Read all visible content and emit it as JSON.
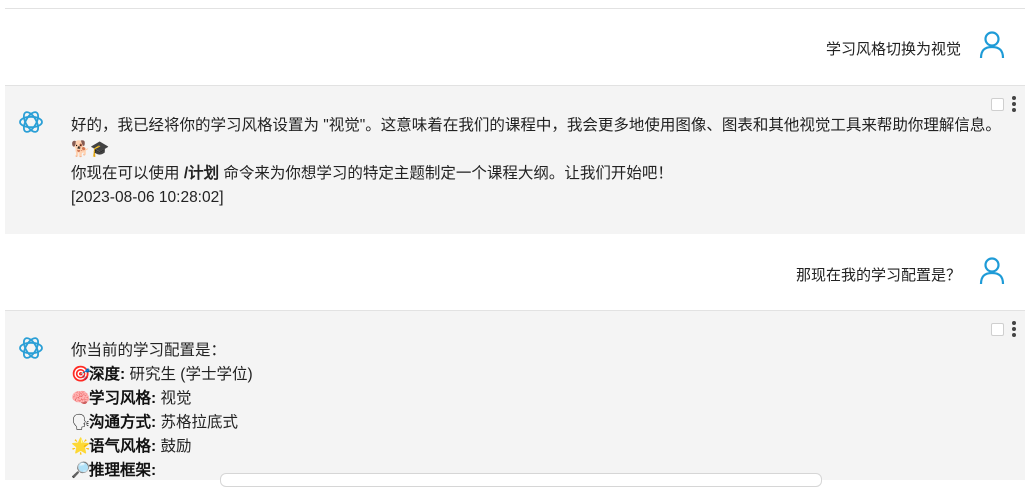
{
  "messages": {
    "user1": {
      "text": "学习风格切换为视觉"
    },
    "ai1": {
      "line1": "好的，我已经将你的学习风格设置为 \"视觉\"。这意味着在我们的课程中，我会更多地使用图像、图表和其他视觉工具来帮助你理解信息。🐕🎓",
      "line2_pre": "你现在可以使用 ",
      "line2_cmd": "/计划",
      "line2_post": " 命令来为你想学习的特定主题制定一个课程大纲。让我们开始吧！",
      "timestamp": "[2023-08-06 10:28:02]"
    },
    "user2": {
      "text": "那现在我的学习配置是？"
    },
    "ai2": {
      "intro": "你当前的学习配置是：",
      "items": [
        {
          "emoji": "🎯",
          "label": "深度:",
          "value": " 研究生 (学士学位)"
        },
        {
          "emoji": "🧠",
          "label": "学习风格:",
          "value": " 视觉"
        },
        {
          "emoji": "🗣",
          "label": "沟通方式:",
          "value": " 苏格拉底式"
        },
        {
          "emoji": "🌟",
          "label": "语气风格:",
          "value": " 鼓励"
        },
        {
          "emoji": "🔎",
          "label": "推理框架:",
          "value": ""
        }
      ]
    }
  },
  "icons": {
    "user_avatar": "user-outline-icon",
    "ai_avatar": "openai-logo-icon",
    "menu": "kebab-menu-icon"
  },
  "colors": {
    "user_avatar": "#1e9bd7",
    "ai_logo": "#2a9fd6",
    "ai_background": "#f4f4f4"
  }
}
